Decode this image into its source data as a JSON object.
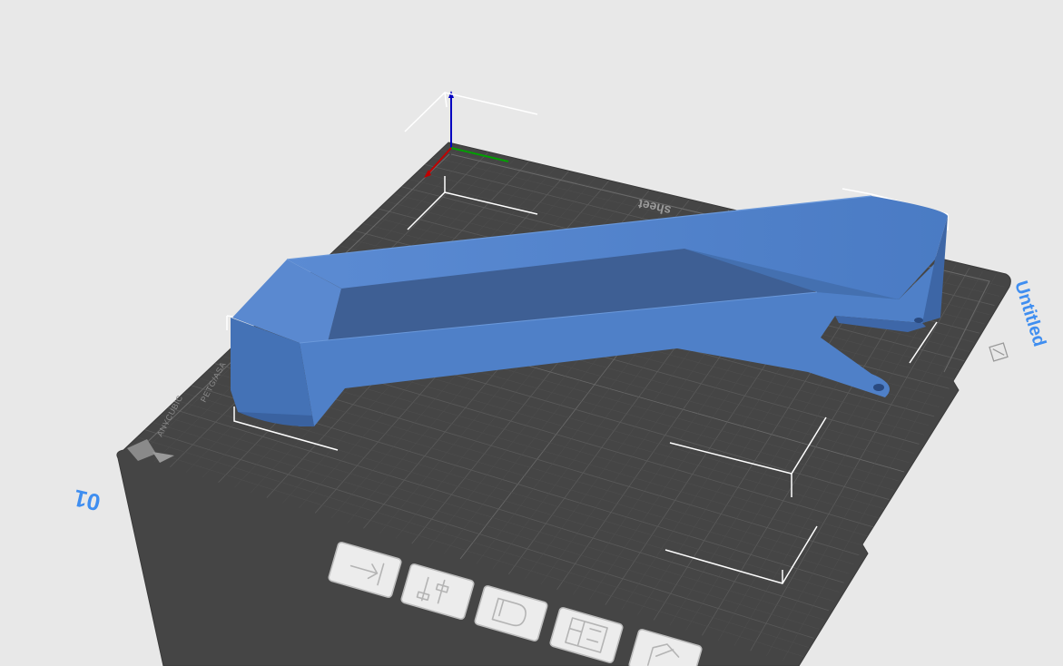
{
  "scene": {
    "plate_index": "01",
    "plate_name": "Untitled",
    "bed_brand_label": "ANYCUBIC",
    "bed_material_label": "PETG/ASA",
    "sheet_label": "sheet"
  },
  "colors": {
    "background": "#e8e8e8",
    "bed": "#4a4a4a",
    "bed_grid": "#5c5c5c",
    "model": "#4f7fc7",
    "accent": "#3f8ef0",
    "axis_x": "#c00000",
    "axis_y": "#00a000",
    "axis_z": "#0000c0"
  },
  "toolbar": {
    "items": [
      {
        "icon": "move-icon"
      },
      {
        "icon": "scale-icon"
      },
      {
        "icon": "rotate-icon"
      },
      {
        "icon": "arrange-icon"
      },
      {
        "icon": "lay-on-face-icon"
      }
    ]
  }
}
